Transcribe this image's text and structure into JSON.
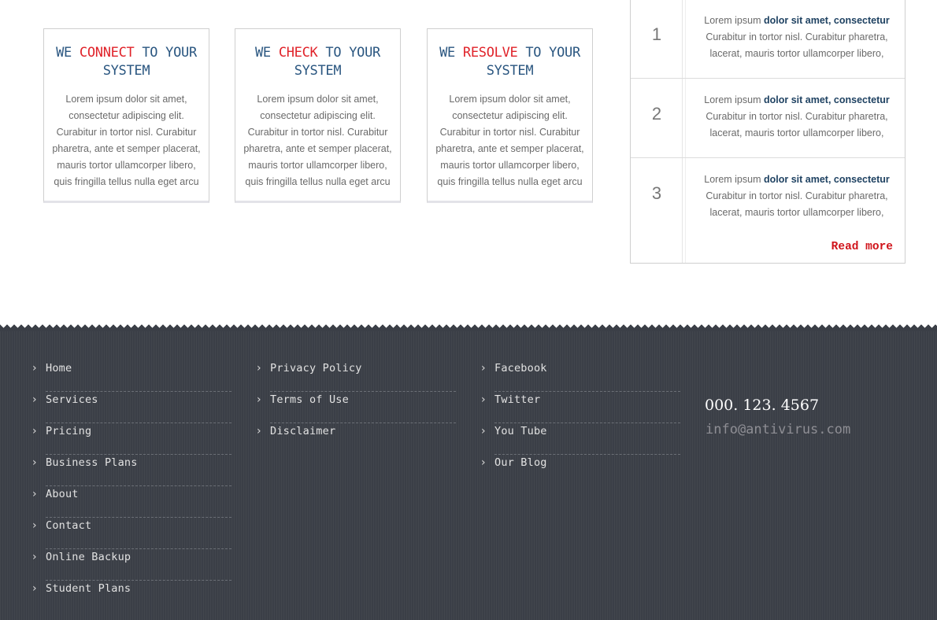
{
  "features": [
    {
      "pre": "WE ",
      "verb": "CONNECT",
      "post": " TO YOUR SYSTEM",
      "body": "Lorem ipsum dolor sit amet, consectetur adipiscing elit. Curabitur in tortor nisl. Curabitur pharetra, ante et semper placerat, mauris tortor ullamcorper libero, quis fringilla tellus nulla eget arcu"
    },
    {
      "pre": "WE ",
      "verb": "CHECK",
      "post": " TO YOUR SYSTEM",
      "body": "Lorem ipsum dolor sit amet, consectetur adipiscing elit. Curabitur in tortor nisl. Curabitur pharetra, ante et semper placerat, mauris tortor ullamcorper libero, quis fringilla tellus nulla eget arcu"
    },
    {
      "pre": "WE ",
      "verb": "RESOLVE",
      "post": " TO YOUR SYSTEM",
      "body": "Lorem ipsum dolor sit amet, consectetur adipiscing elit. Curabitur in tortor nisl. Curabitur pharetra, ante et semper placerat, mauris tortor ullamcorper libero, quis fringilla tellus nulla eget arcu"
    }
  ],
  "list": {
    "items": [
      {
        "num": "1",
        "lead": "Lorem ipsum ",
        "bold": "dolor sit amet, consectetur",
        "rest": " Curabitur in tortor nisl. Curabitur pharetra, lacerat, mauris tortor ullamcorper libero,"
      },
      {
        "num": "2",
        "lead": "Lorem ipsum ",
        "bold": "dolor sit amet, consectetur",
        "rest": " Curabitur in tortor nisl. Curabitur pharetra, lacerat, mauris tortor ullamcorper libero,"
      },
      {
        "num": "3",
        "lead": "Lorem ipsum ",
        "bold": "dolor sit amet, consectetur",
        "rest": " Curabitur in tortor nisl. Curabitur pharetra, lacerat, mauris tortor ullamcorper libero,"
      }
    ],
    "read_more": "Read more"
  },
  "footer": {
    "col1": [
      "Home",
      "Services",
      "Pricing",
      "Business Plans",
      "About",
      "Contact",
      "Online Backup",
      "Student Plans"
    ],
    "col2": [
      "Privacy Policy",
      "Terms of Use",
      "Disclaimer"
    ],
    "col3": [
      "Facebook",
      "Twitter",
      "You Tube",
      "Our Blog"
    ],
    "chevron": "›",
    "phone": "000. 123. 4567",
    "email": "info@antivirus.com"
  },
  "colors": {
    "heading_blue": "#2a5680",
    "accent_red": "#e0232a",
    "footer_bg": "#3b3f47"
  }
}
